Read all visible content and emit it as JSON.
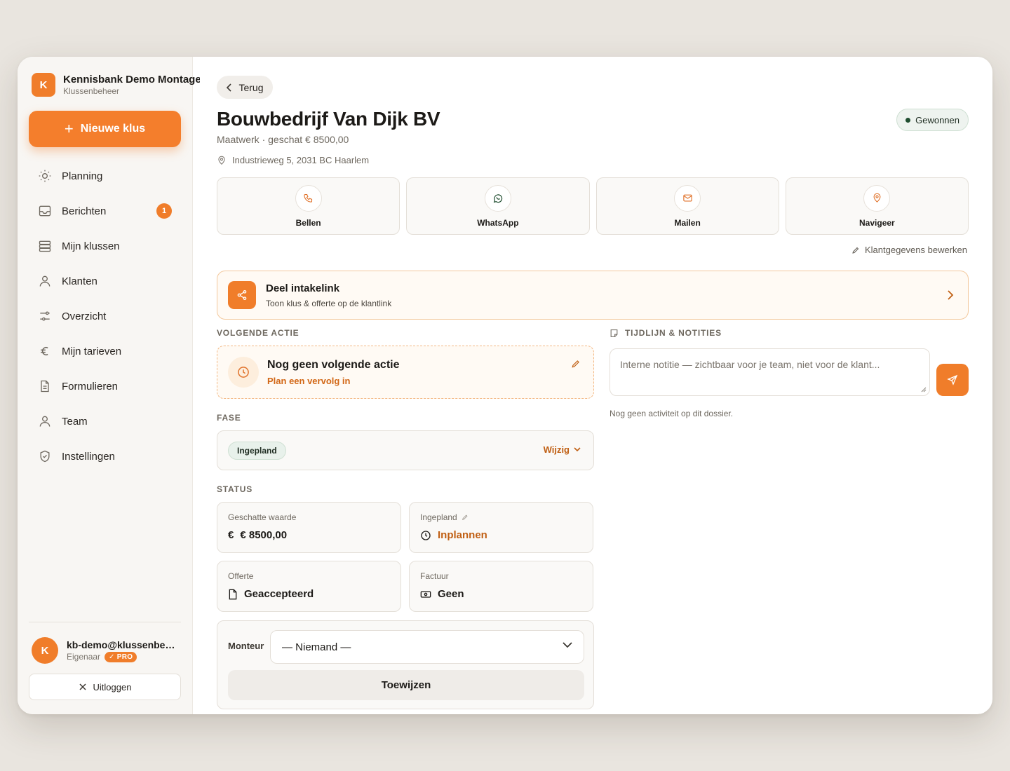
{
  "brand": {
    "name": "Kennisbank Demo Montage",
    "subtitle": "Klussenbeheer",
    "logo_letter": "K"
  },
  "sidebar": {
    "new_button": "Nieuwe klus",
    "items": [
      {
        "label": "Planning",
        "icon": "sun-icon"
      },
      {
        "label": "Berichten",
        "icon": "inbox-icon",
        "badge": "1"
      },
      {
        "label": "Mijn klussen",
        "icon": "stack-icon"
      },
      {
        "label": "Klanten",
        "icon": "user-icon"
      },
      {
        "label": "Overzicht",
        "icon": "sliders-icon"
      },
      {
        "label": "Mijn tarieven",
        "icon": "euro-icon"
      },
      {
        "label": "Formulieren",
        "icon": "document-icon"
      },
      {
        "label": "Team",
        "icon": "user-icon"
      },
      {
        "label": "Instellingen",
        "icon": "shield-icon"
      }
    ],
    "user": {
      "initial": "K",
      "email": "kb-demo@klussenbeheer.nl",
      "role": "Eigenaar",
      "badge": "✓ PRO"
    },
    "logout": "Uitloggen"
  },
  "header": {
    "back": "Terug",
    "title": "Bouwbedrijf Van Dijk BV",
    "subtitle": "Maatwerk · geschat € 8500,00",
    "address": "Industrieweg 5, 2031 BC Haarlem",
    "status": "Gewonnen"
  },
  "actions": [
    {
      "label": "Bellen",
      "icon": "phone-icon"
    },
    {
      "label": "WhatsApp",
      "icon": "whatsapp-icon"
    },
    {
      "label": "Mailen",
      "icon": "mail-icon"
    },
    {
      "label": "Navigeer",
      "icon": "map-pin-icon"
    }
  ],
  "edit_client": "Klantgegevens bewerken",
  "intake": {
    "title": "Deel intakelink",
    "subtitle": "Toon klus & offerte op de klantlink"
  },
  "next_action": {
    "section": "VOLGENDE ACTIE",
    "title": "Nog geen volgende actie",
    "subtitle": "Plan een vervolg in"
  },
  "phase": {
    "section": "FASE",
    "value": "Ingepland",
    "change": "Wijzig"
  },
  "status": {
    "section": "STATUS",
    "cards": [
      {
        "label": "Geschatte waarde",
        "value": "€ 8500,00",
        "prefix": "€"
      },
      {
        "label": "Ingepland",
        "value": "Inplannen"
      },
      {
        "label": "Offerte",
        "value": "Geaccepteerd"
      },
      {
        "label": "Factuur",
        "value": "Geen"
      }
    ]
  },
  "assign": {
    "label": "Monteur",
    "selected": "— Niemand —",
    "button": "Toewijzen"
  },
  "timeline": {
    "section": "TIJDLIJN & NOTITIES",
    "placeholder": "Interne notitie — zichtbaar voor je team, niet voor de klant...",
    "empty": "Nog geen activiteit op dit dossier."
  },
  "colors": {
    "accent": "#f07d2a",
    "success": "#1f4d2f"
  }
}
